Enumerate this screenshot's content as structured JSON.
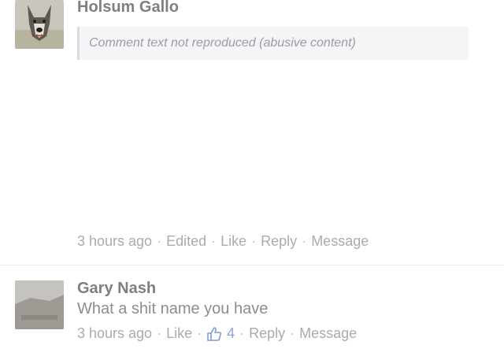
{
  "comments": [
    {
      "author": "Holsum Gallo",
      "avatar_icon": "dog-photo-avatar",
      "body_withheld_note": "Comment text not reproduced (abusive content)",
      "meta": {
        "time": "3 hours ago",
        "edited": "Edited",
        "like": "Like",
        "reply": "Reply",
        "message": "Message"
      }
    },
    {
      "author": "Gary Nash",
      "avatar_icon": "photo-avatar",
      "text": "What a shit name you have",
      "meta": {
        "time": "3 hours ago",
        "like": "Like",
        "like_count": "4",
        "reply": "Reply",
        "message": "Message"
      }
    }
  ],
  "colors": {
    "author": "#7f7f7f",
    "meta": "#a8abaf",
    "like_icon": "#7f9cd6",
    "divider": "#e9ebee"
  }
}
